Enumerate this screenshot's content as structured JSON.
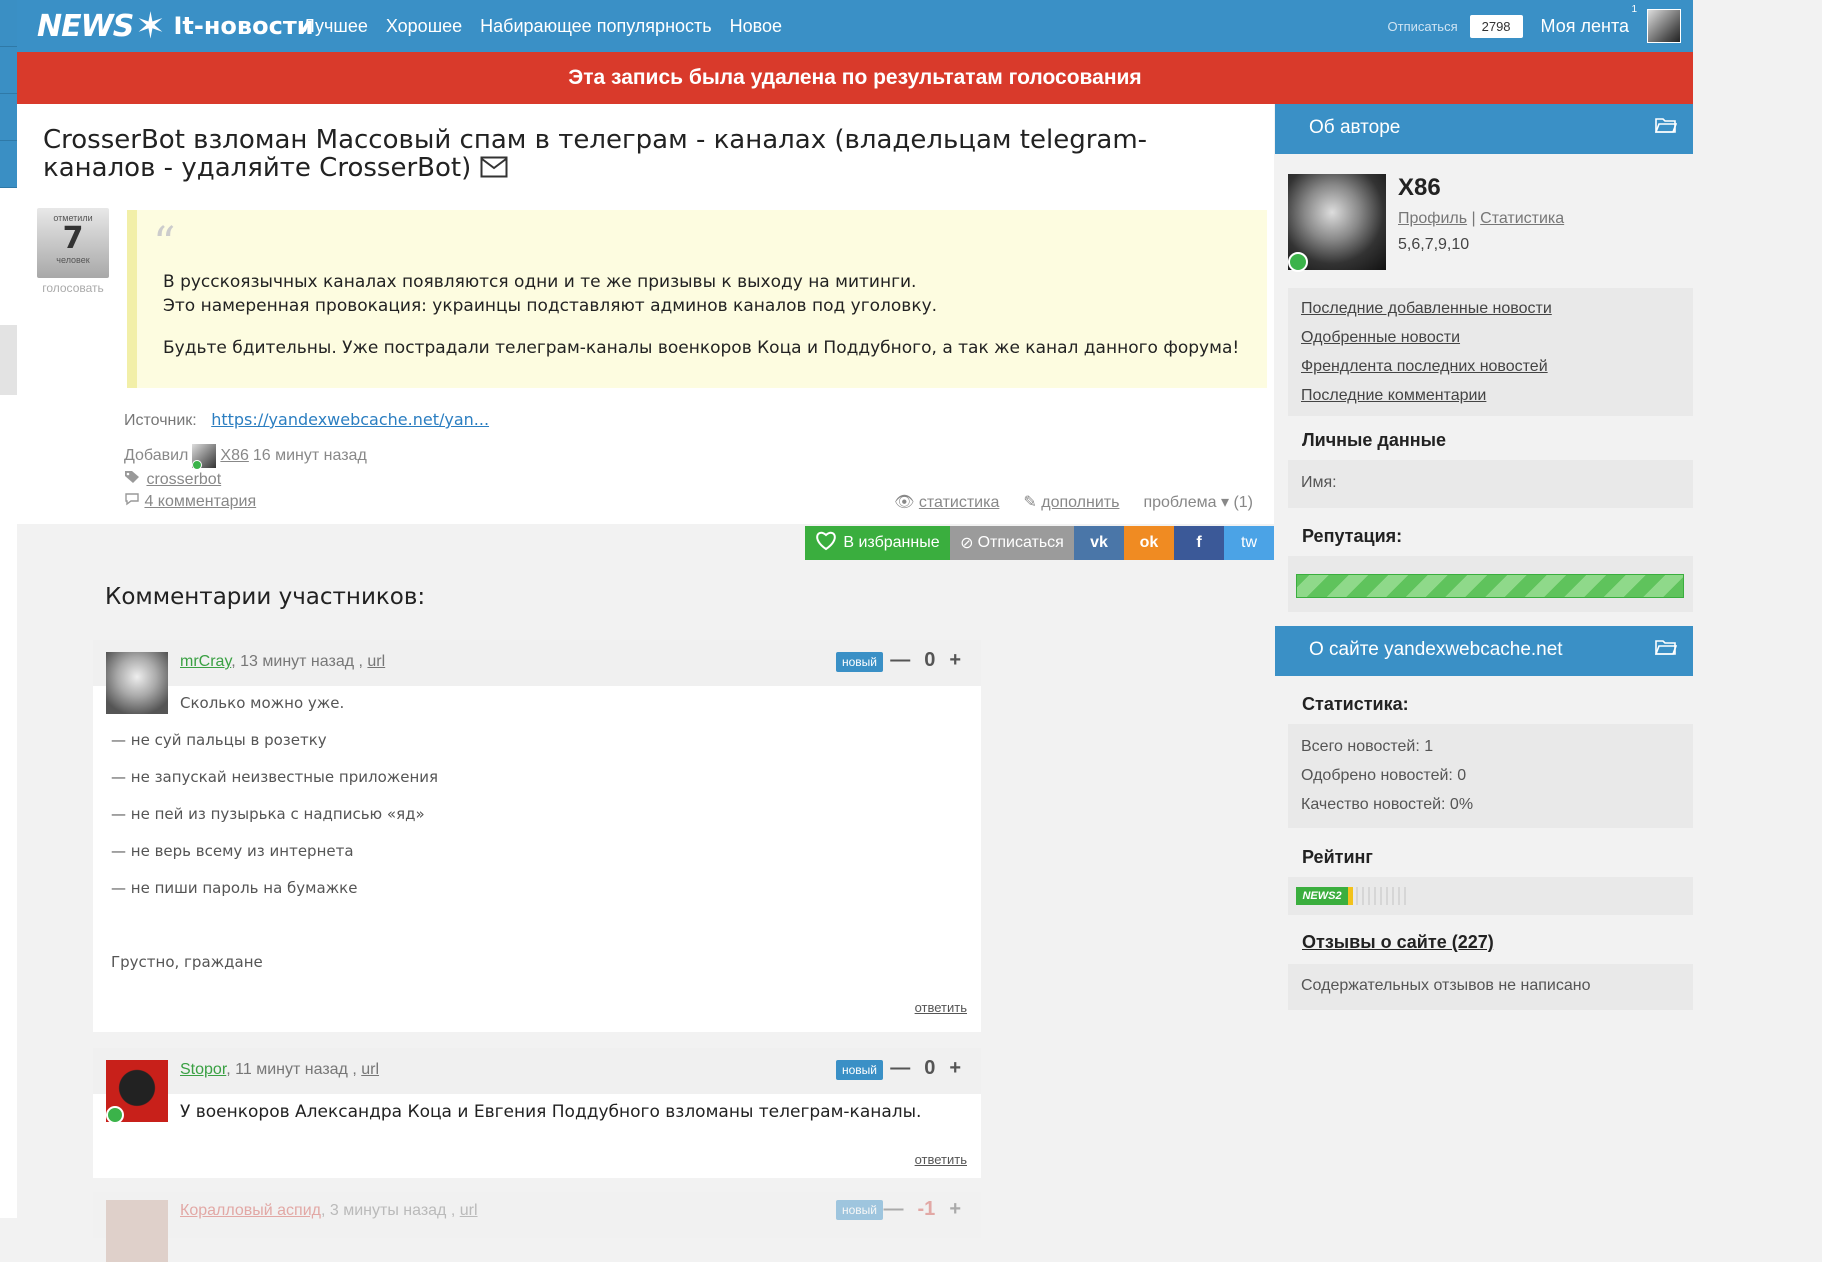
{
  "header": {
    "logo_news": "NEWS",
    "logo_num": "2",
    "site_name": "It-новости",
    "nav": [
      "Лучшее",
      "Хорошее",
      "Набирающее популярность",
      "Новое"
    ],
    "unsubscribe": "Отписаться",
    "subscribers": "2798",
    "my_feed": "Моя лента",
    "my_feed_count": "1"
  },
  "banner": {
    "text": "Эта запись была удалена по результатам голосования",
    "color": "#d93a2b"
  },
  "article": {
    "title": "CrosserBot взломан Массовый спам в телеграм - каналах (владельцам telegram-каналов - удаляйте CrosserBot)",
    "vote": {
      "top_label": "отметили",
      "count": "7",
      "bottom_label": "человек",
      "action": "голосовать"
    },
    "quote_mark": "“",
    "paragraphs": [
      "В русскоязычных каналах появляются одни и те же призывы к выходу на митинги.",
      "Это намеренная провокация: украинцы подставляют админов каналов под уголовку.",
      "Будьте бдительны. Уже пострадали телеграм-каналы военкоров Коца и Поддубного, а так же канал данного форума!"
    ],
    "source_label": "Источник:",
    "source_url": "https://yandexwebcache.net/yan...",
    "added_label": "Добавил",
    "added_by": "X86",
    "added_time": "16 минут назад",
    "tag": "crosserbot",
    "comments_link": "4 комментария",
    "actions": {
      "stats": "статистика",
      "supplement": "дополнить",
      "problem": "проблема",
      "problem_count": "(1)"
    }
  },
  "share": {
    "favorite": "В избранные",
    "unsubscribe": "Отписаться",
    "vk": "vk",
    "ok": "ok",
    "fb": "f",
    "tw": "tw"
  },
  "comments": {
    "heading": "Комментарии участников:",
    "items": [
      {
        "author": "mrCray",
        "time": ", 13 минут назад ,",
        "url": "url",
        "badge": "новый",
        "score": "0",
        "lines": [
          "Сколько можно уже.",
          "— не суй пальцы в розетку",
          "— не запускай неизвестные приложения",
          "— не пей из пузырька с надписью «яд»",
          "— не верь всему из интернета",
          "— не пиши пароль на бумажке",
          "Грустно, граждане"
        ],
        "reply": "ответить"
      },
      {
        "author": "Stopor",
        "time": ", 11 минут назад ,",
        "url": "url",
        "badge": "новый",
        "score": "0",
        "text": "У военкоров Александра Коца и Евгения Поддубного взломаны телеграм-каналы.",
        "reply": "ответить"
      },
      {
        "author": "Коралловый аспид",
        "time": ", 3 минуты назад ,",
        "url": "url",
        "badge": "новый",
        "score": "-1"
      }
    ]
  },
  "sidebar": {
    "about_author": "Об авторе",
    "author_name": "X86",
    "profile": "Профиль",
    "separator": "|",
    "statistics": "Статистика",
    "ranks": "5,6,7,9,10",
    "menu": [
      "Последние добавленные новости",
      "Одобренные новости",
      "Френдлента последних новостей",
      "Последние комментарии"
    ],
    "personal_data": "Личные данные",
    "name_label": "Имя:",
    "reputation": "Репутация:",
    "about_site": "О сайте yandexwebcache.net",
    "stats_label": "Статистика:",
    "stats": [
      "Всего новостей: 1",
      "Одобрено новостей: 0",
      "Качество новостей: 0%"
    ],
    "rating": "Рейтинг",
    "rating_logo": "NEWS2",
    "reviews": "Отзывы о сайте (227)",
    "reviews_text": "Содержательных отзывов не написано"
  }
}
